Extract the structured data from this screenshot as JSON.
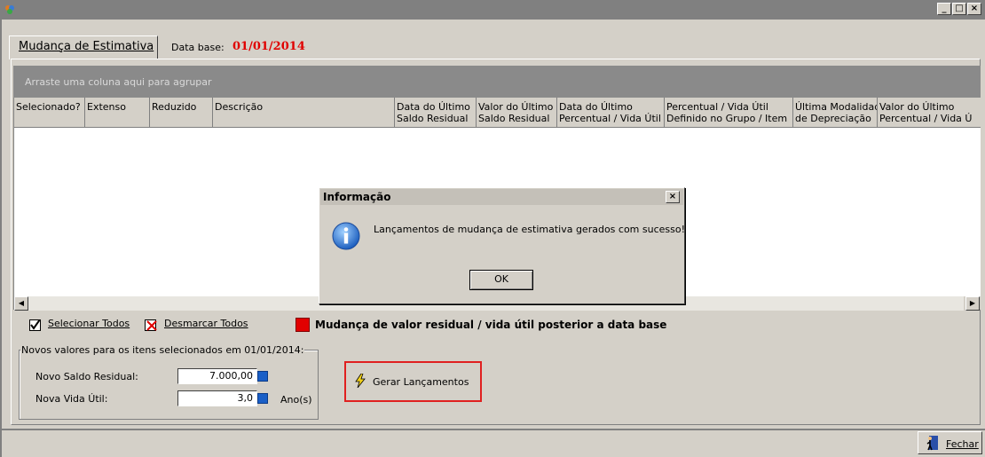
{
  "window": {
    "minimize": "_",
    "maximize": "□",
    "close": "×"
  },
  "tab": {
    "label": "Mudança de Estimativa"
  },
  "data_base": {
    "label": "Data base:",
    "value": "01/01/2014"
  },
  "grid": {
    "group_hint": "Arraste uma coluna aqui para agrupar",
    "columns": [
      [
        "Selecionado?",
        ""
      ],
      [
        "Extenso",
        ""
      ],
      [
        "Reduzido",
        ""
      ],
      [
        "Descrição",
        ""
      ],
      [
        "Data do Último",
        "Saldo Residual"
      ],
      [
        "Valor do Último",
        "Saldo Residual"
      ],
      [
        "Data do Último",
        "Percentual / Vida Útil"
      ],
      [
        "Percentual / Vida Útil",
        "Definido no Grupo / Item"
      ],
      [
        "Última Modalidade",
        "de Depreciação"
      ],
      [
        "Valor do Último",
        "Percentual / Vida Ú"
      ]
    ]
  },
  "actions": {
    "select_all": "Selecionar Todos",
    "unselect_all": "Desmarcar Todos",
    "legend_text": "Mudança de valor residual / vida útil posterior a data base",
    "legend_color": "#e10000"
  },
  "fieldset": {
    "legend": "Novos valores para os itens selecionados em  01/01/2014:",
    "saldo_label": "Novo Saldo Residual:",
    "saldo_value": "7.000,00",
    "vida_label": "Nova Vida Útil:",
    "vida_value": "3,0",
    "vida_unit": "Ano(s)"
  },
  "gerar": {
    "label": "Gerar Lançamentos"
  },
  "footer": {
    "fechar": "Fechar"
  },
  "dialog": {
    "title": "Informação",
    "close": "×",
    "message": "Lançamentos de mudança de estimativa gerados com sucesso!",
    "ok": "OK"
  }
}
